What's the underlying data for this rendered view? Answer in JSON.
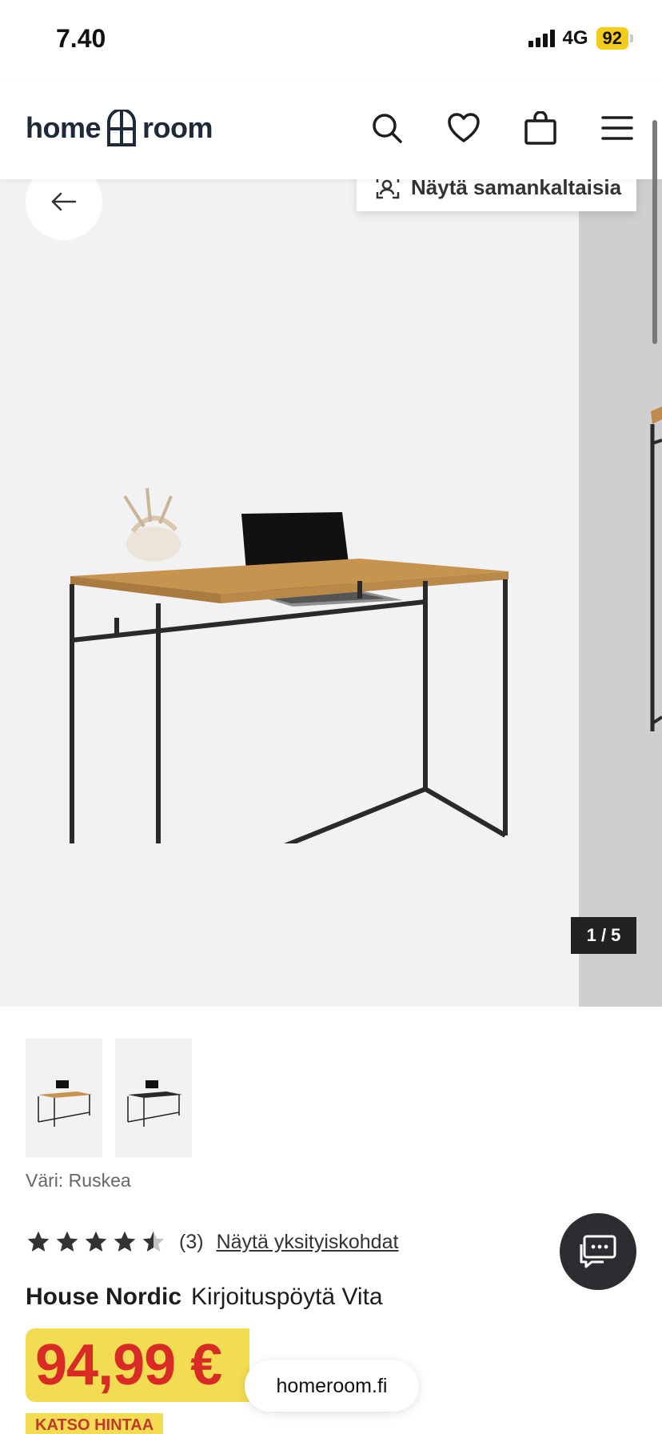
{
  "status_bar": {
    "time": "7.40",
    "network": "4G",
    "battery": "92"
  },
  "header": {
    "logo": {
      "left": "home",
      "right": "room"
    },
    "icons": [
      "search-icon",
      "heart-icon",
      "shopping-bag-icon",
      "menu-icon"
    ]
  },
  "gallery": {
    "similar_label": "Näytä samankaltaisia",
    "counter": "1 / 5"
  },
  "product": {
    "color_label": "Väri: Ruskea",
    "rating": {
      "value": 4.5,
      "count": "(3)",
      "details_link": "Näytä yksityiskohdat"
    },
    "brand": "House Nordic",
    "name": "Kirjoituspöytä Vita",
    "price": "94,99 €",
    "deal_tag": "KATSO HINTAA"
  },
  "browser": {
    "url": "homeroom.fi"
  },
  "colors": {
    "price_red": "#d92b26",
    "price_bg": "#f2dd52",
    "dark": "#2b2d31"
  }
}
